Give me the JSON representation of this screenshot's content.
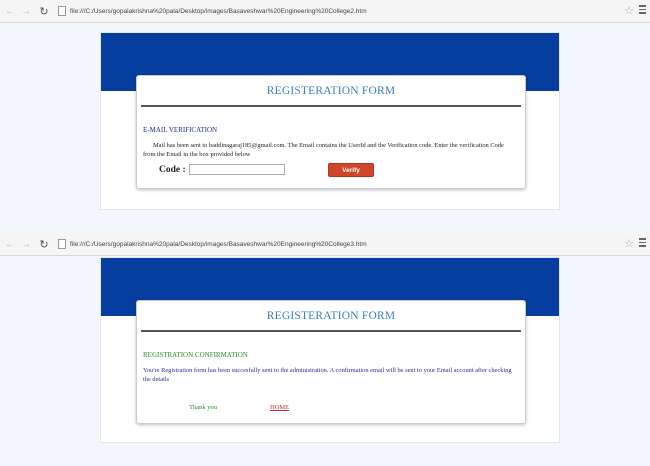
{
  "windows": [
    {
      "url": "file:///C:/Users/gopalakrishna%20pala/Desktop/images/Basaveshwar%20Engineering%20College2.htm",
      "form_title": "REGISTERATION FORM",
      "section_title": "E-MAIL VERIFICATION",
      "body": "Mail has been sent to baddinagaraj185@gmail.com. The Email contains the UserId and the Verification code. Enter the verification Code from the Email in the box provided below",
      "code_label": "Code :",
      "code_value": "",
      "verify_label": "Verify"
    },
    {
      "url": "file:///C:/Users/gopalakrishna%20pala/Desktop/images/Basaveshwar%20Engineering%20College3.htm",
      "form_title": "REGISTERATION FORM",
      "section_title": "REGISTRATION CONFIRMATION",
      "body": "You're Registration form has been succesfully sent to the administration. A confirmation email will be sent to your Email account after checking the details",
      "thank_you": "Thank you",
      "home_link": "HOME"
    }
  ],
  "icons": {
    "back": "back-arrow-icon",
    "forward": "forward-arrow-icon",
    "reload": "reload-icon",
    "page": "page-icon",
    "bookmark": "star-icon",
    "menu": "menu-icon"
  },
  "colors": {
    "banner": "#063ea0",
    "title": "#3a7fc0",
    "verify_button": "#d0462a",
    "confirmation_green": "#2a8a2a",
    "home_link": "#c0302a"
  }
}
